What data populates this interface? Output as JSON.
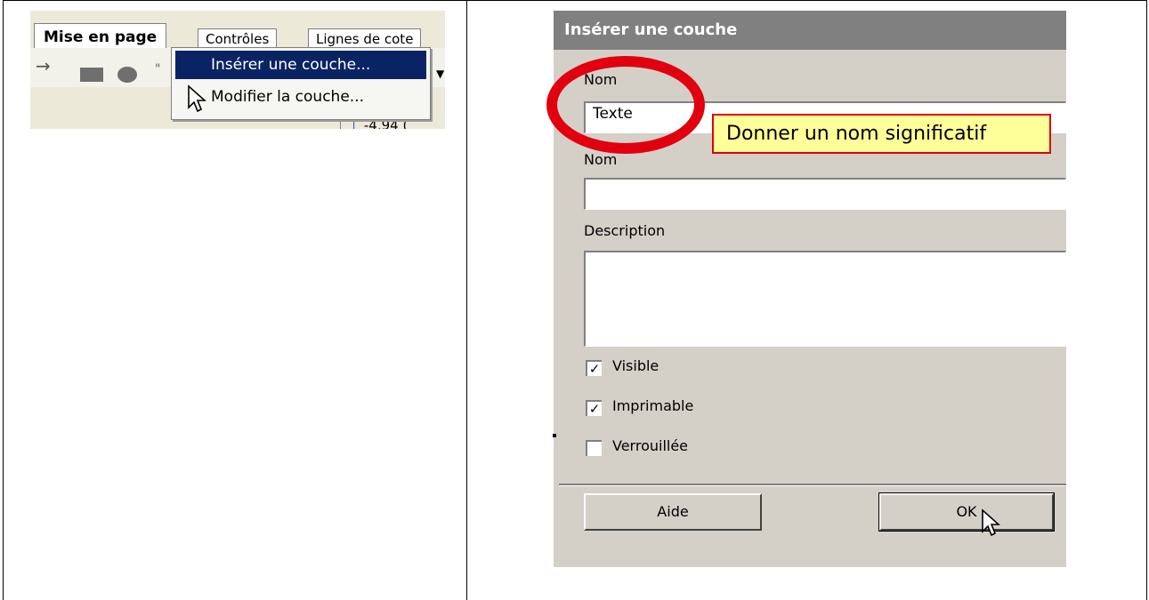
{
  "left_screenshot": {
    "tabs": {
      "active": "Mise en page",
      "second": "Contrôles",
      "third": "Lignes de cote"
    },
    "context_menu": {
      "insert_label": "Insérer une couche...",
      "modify_label": "Modifier la couche..."
    },
    "status_text": "-4,94 ("
  },
  "dialog": {
    "title": "Insérer une couche",
    "name_label": "Nom",
    "name_value": "Texte",
    "title_label": "Nom",
    "title_value": "",
    "description_label": "Description",
    "description_value": "",
    "visible_label": "Visible",
    "visible_checked": true,
    "printable_label": "Imprimable",
    "printable_checked": true,
    "locked_label": "Verrouillée",
    "locked_checked": false,
    "help_button": "Aide",
    "ok_button": "OK"
  },
  "annotation": {
    "callout_text": "Donner un nom significatif",
    "highlight_color": "#e0000f",
    "callout_bg": "#ffff99"
  },
  "colors": {
    "menu_highlight": "#0a2463",
    "dialog_bg": "#d4d0c8",
    "titlebar_bg": "#808080"
  }
}
